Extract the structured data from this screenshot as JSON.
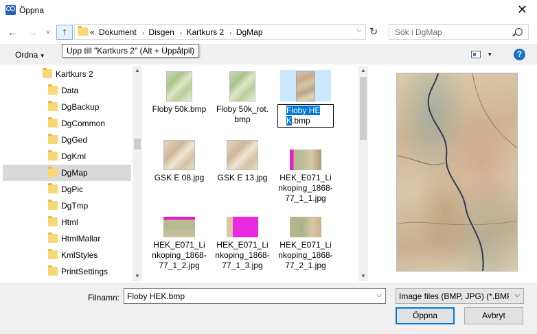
{
  "window": {
    "title": "Öppna",
    "close_glyph": "✕"
  },
  "nav": {
    "back_glyph": "←",
    "forward_glyph": "→",
    "recent_glyph": "˅",
    "up_glyph": "↑",
    "refresh_glyph": "↻",
    "address": {
      "overflow": "«",
      "crumbs": [
        "Dokument",
        "Disgen",
        "Kartkurs 2",
        "DgMap"
      ],
      "separator": "›",
      "dropdown": "⌵"
    },
    "search_placeholder": "Sök i DgMap"
  },
  "toolbar": {
    "organize_label": "Ordna",
    "organize_arrow": "▾",
    "view_arrow": "▾",
    "help_glyph": "?"
  },
  "tooltip": "Upp till \"Kartkurs 2\" (Alt + Uppåtpil)",
  "nav_pane": {
    "items": [
      {
        "label": "Kartkurs 2",
        "level": 0,
        "selected": false
      },
      {
        "label": "Data",
        "level": 1,
        "selected": false
      },
      {
        "label": "DgBackup",
        "level": 1,
        "selected": false
      },
      {
        "label": "DgCommon",
        "level": 1,
        "selected": false
      },
      {
        "label": "DgGed",
        "level": 1,
        "selected": false
      },
      {
        "label": "DgKml",
        "level": 1,
        "selected": false
      },
      {
        "label": "DgMap",
        "level": 1,
        "selected": true
      },
      {
        "label": "DgPic",
        "level": 1,
        "selected": false
      },
      {
        "label": "DgTmp",
        "level": 1,
        "selected": false
      },
      {
        "label": "Html",
        "level": 1,
        "selected": false
      },
      {
        "label": "HtmlMallar",
        "level": 1,
        "selected": false
      },
      {
        "label": "KmlStyles",
        "level": 1,
        "selected": false
      },
      {
        "label": "PrintSettings",
        "level": 1,
        "selected": false
      }
    ]
  },
  "files": [
    {
      "name": "Floby 50k.bmp",
      "thumb": "green"
    },
    {
      "name": "Floby 50k_rot.bmp",
      "thumb": "green"
    },
    {
      "name_selected_part": "Floby HEK",
      "name_rest": ".bmp",
      "thumb": "old",
      "selected": true
    },
    {
      "name": "GSK E 08.jpg",
      "thumb": "tan"
    },
    {
      "name": "GSK E 13.jpg",
      "thumb": "tan"
    },
    {
      "name": "HEK_E071_Linkoping_1868-77_1_1.jpg",
      "thumb": "magenta"
    },
    {
      "name": "HEK_E071_Linkoping_1868-77_1_2.jpg",
      "thumb": "magenta-top"
    },
    {
      "name": "HEK_E071_Linkoping_1868-77_1_3.jpg",
      "thumb": "magenta-right"
    },
    {
      "name": "HEK_E071_Linkoping_1868-77_2_1.jpg",
      "thumb": "magenta2"
    }
  ],
  "scroll_glyphs": {
    "up": "▲",
    "down": "▼"
  },
  "bottom": {
    "filename_label": "Filnamn:",
    "filename_value": "Floby HEK.bmp",
    "filetype_value": "Image files (BMP, JPG) (*.BMP;*",
    "dropdown_glyph": "⌵",
    "open_label": "Öppna",
    "cancel_label": "Avbryt"
  },
  "colors": {
    "accent": "#0078d7",
    "selection_bg": "#cce8ff",
    "nav_selected": "#d9d9d9",
    "toolbar_bg": "#f0f0f0",
    "folder": "#f8d775"
  }
}
